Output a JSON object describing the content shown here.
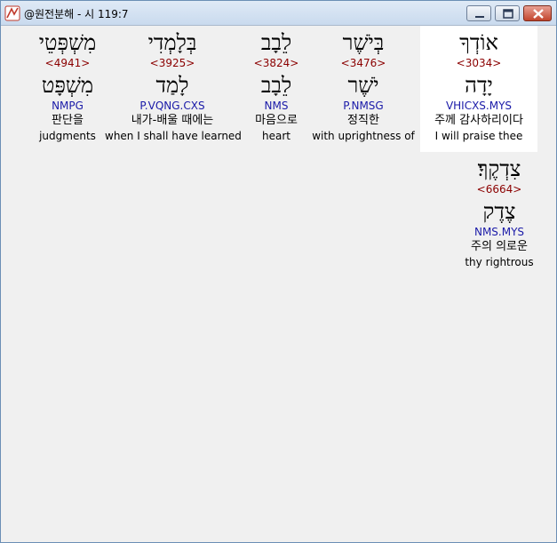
{
  "window": {
    "title": "@원전분해 - 시 119:7"
  },
  "words": [
    {
      "hebrew": "אוֹדְךָ",
      "strong": "<3034>",
      "lemma": "יָדָה",
      "morph": "VHICXS.MYS",
      "korean": "주께 감사하리이다",
      "english": "I will praise thee",
      "highlighted": true
    },
    {
      "hebrew": "בְּיֹשֶׁר",
      "strong": "<3476>",
      "lemma": "יֹשֶׁר",
      "morph": "P.NMSG",
      "korean": "정직한",
      "english": "with uprightness of",
      "highlighted": false
    },
    {
      "hebrew": "לֵבָב",
      "strong": "<3824>",
      "lemma": "לֵבָב",
      "morph": "NMS",
      "korean": "마음으로",
      "english": "heart",
      "highlighted": false
    },
    {
      "hebrew": "בְּלָמְדִי",
      "strong": "<3925>",
      "lemma": "לָמַד",
      "morph": "P.VQNG.CXS",
      "korean": "내가-배울 때에는",
      "english": "when I shall have learned",
      "highlighted": false
    },
    {
      "hebrew": "מִשְׁפְּטֵי",
      "strong": "<4941>",
      "lemma": "מִשְׁפָּט",
      "morph": "NMPG",
      "korean": "판단을",
      "english": "judgments",
      "highlighted": false
    },
    {
      "hebrew": "צִדְקֶךָ׃",
      "strong": "<6664>",
      "lemma": "צֶדֶק",
      "morph": "NMS.MYS",
      "korean": "주의 의로운",
      "english": "thy rightrous",
      "highlighted": false
    }
  ]
}
